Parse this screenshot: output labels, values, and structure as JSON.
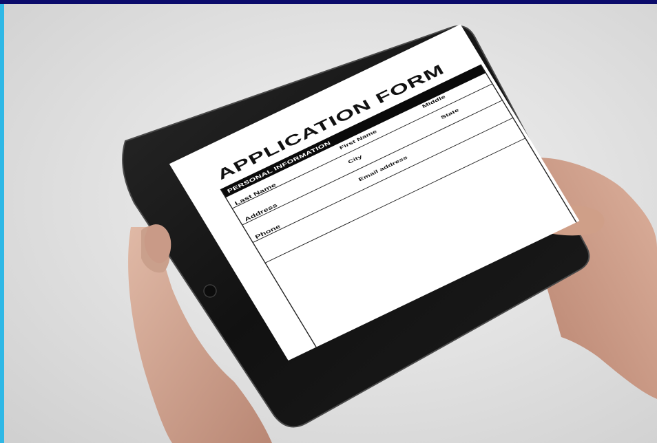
{
  "form": {
    "title": "APPLICATION FORM",
    "section": "PERSONAL INFORMATION",
    "fields": {
      "last_name": "Last Name",
      "first_name": "First Name",
      "middle": "Middle",
      "address": "Address",
      "city": "City",
      "state": "State",
      "phone": "Phone",
      "email": "Email address"
    }
  },
  "colors": {
    "tablet_bezel": "#161616",
    "screen": "#ffffff",
    "skin": "#d4a995",
    "header_bar": "#0b0b6b",
    "side_strip": "#2fb8e6"
  }
}
